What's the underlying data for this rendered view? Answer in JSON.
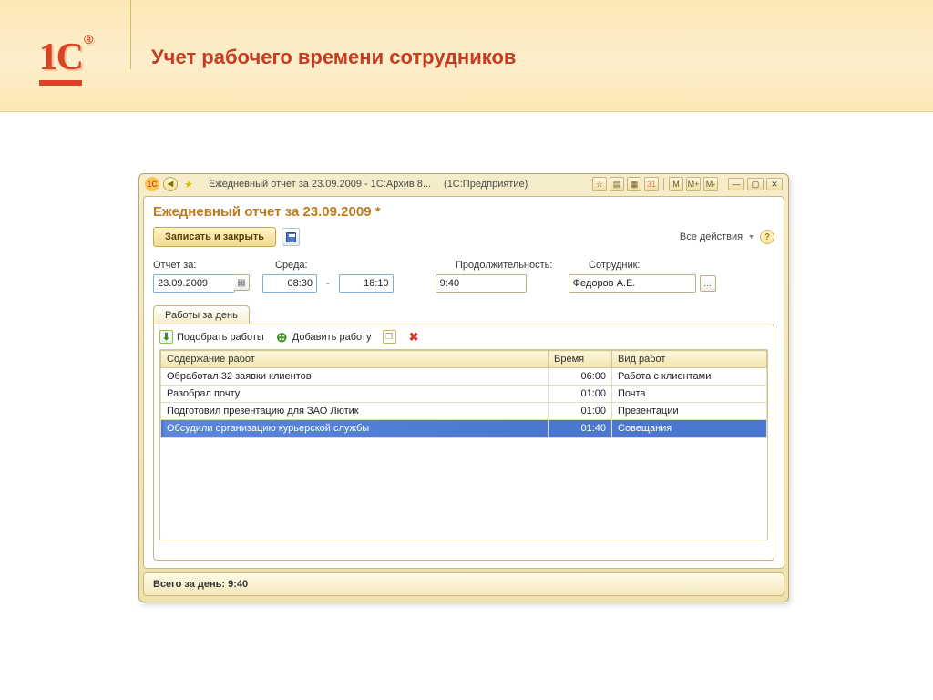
{
  "slide": {
    "logo_text": "1C",
    "registered": "®",
    "title": "Учет рабочего времени сотрудников"
  },
  "titlebar": {
    "title_left": "Ежедневный отчет за 23.09.2009 - 1С:Архив 8...",
    "title_right": "(1С:Предприятие)",
    "m_btns": {
      "m": "M",
      "mplus": "M+",
      "mminus": "M-"
    }
  },
  "doc": {
    "title": "Ежедневный отчет за 23.09.2009 *",
    "save_close": "Записать и закрыть",
    "all_actions": "Все действия",
    "labels": {
      "report_for": "Отчет за:",
      "wed": "Среда:",
      "duration": "Продолжительность:",
      "employee": "Сотрудник:"
    },
    "values": {
      "date": "23.09.2009",
      "start": "08:30",
      "end": "18:10",
      "duration": "9:40",
      "employee": "Федоров А.Е."
    },
    "tab_label": "Работы за день",
    "tools": {
      "pick": "Подобрать работы",
      "add": "Добавить работу"
    },
    "columns": {
      "content": "Содержание работ",
      "time": "Время",
      "kind": "Вид работ"
    },
    "rows": [
      {
        "content": "Обработал 32 заявки клиентов",
        "time": "06:00",
        "kind": "Работа с клиентами"
      },
      {
        "content": "Разобрал почту",
        "time": "01:00",
        "kind": "Почта"
      },
      {
        "content": "Подготовил презентацию для ЗАО Лютик",
        "time": "01:00",
        "kind": "Презентации"
      },
      {
        "content": "Обсудили организацию курьерской службы",
        "time": "01:40",
        "kind": "Совещания"
      }
    ],
    "footer": "Всего за день: 9:40"
  }
}
